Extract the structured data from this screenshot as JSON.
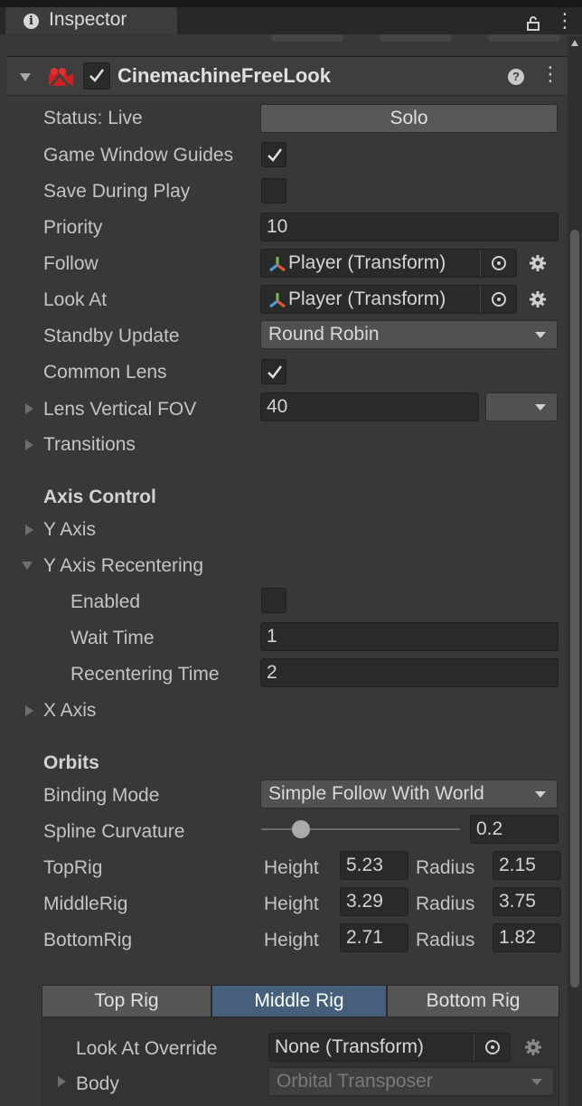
{
  "window": {
    "tab_label": "Inspector",
    "tab_icon": "info-icon",
    "icons": [
      "lock-icon",
      "kebab-menu-icon"
    ]
  },
  "component": {
    "title": "CinemachineFreeLook",
    "enabled": true,
    "icon": "cinemachine-camera-icon",
    "header_icons": [
      "help-icon",
      "kebab-menu-icon"
    ]
  },
  "fields": {
    "status": {
      "label": "Status: Live",
      "button": "Solo"
    },
    "game_window_guides": {
      "label": "Game Window Guides",
      "checked": true
    },
    "save_during_play": {
      "label": "Save During Play",
      "checked": false
    },
    "priority": {
      "label": "Priority",
      "value": "10"
    },
    "follow": {
      "label": "Follow",
      "value": "Player (Transform)"
    },
    "look_at": {
      "label": "Look At",
      "value": "Player (Transform)"
    },
    "standby_update": {
      "label": "Standby Update",
      "value": "Round Robin"
    },
    "common_lens": {
      "label": "Common Lens",
      "checked": true
    },
    "lens_vertical_fov": {
      "label": "Lens Vertical FOV",
      "value": "40",
      "preset": ""
    },
    "transitions": {
      "label": "Transitions"
    }
  },
  "axis_control": {
    "heading": "Axis Control",
    "y_axis": "Y Axis",
    "y_axis_recentering": {
      "label": "Y Axis Recentering",
      "enabled_label": "Enabled",
      "enabled": false,
      "wait_time_label": "Wait Time",
      "wait_time": "1",
      "recentering_time_label": "Recentering Time",
      "recentering_time": "2"
    },
    "x_axis": "X Axis"
  },
  "orbits": {
    "heading": "Orbits",
    "binding_mode": {
      "label": "Binding Mode",
      "value": "Simple Follow With World"
    },
    "spline_curvature": {
      "label": "Spline Curvature",
      "value": "0.2",
      "fraction": 0.2
    },
    "height_label": "Height",
    "radius_label": "Radius",
    "rigs": [
      {
        "name": "TopRig",
        "height": "5.23",
        "radius": "2.15"
      },
      {
        "name": "MiddleRig",
        "height": "3.29",
        "radius": "3.75"
      },
      {
        "name": "BottomRig",
        "height": "2.71",
        "radius": "1.82"
      }
    ]
  },
  "rig_tabs": {
    "tabs": [
      "Top Rig",
      "Middle Rig",
      "Bottom Rig"
    ],
    "selected": "Middle Rig",
    "selected_color": "#46607c"
  },
  "rig_panel": {
    "look_at_override": {
      "label": "Look At Override",
      "value": "None (Transform)"
    },
    "body": {
      "label": "Body",
      "value": "Orbital Transposer"
    }
  }
}
